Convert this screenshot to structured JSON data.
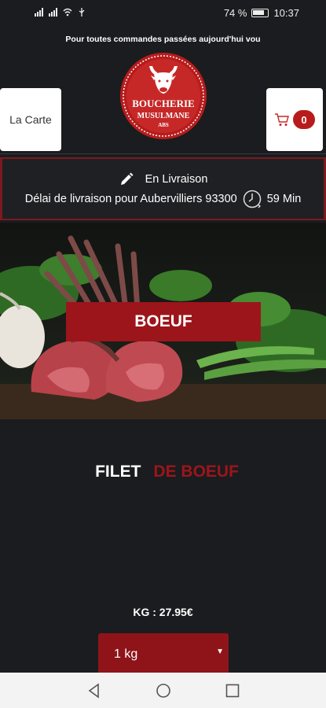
{
  "status": {
    "battery": "74 %",
    "time": "10:37"
  },
  "promo_text": "Pour toutes commandes passées aujourd'hui vou",
  "header": {
    "menu_label": "La Carte",
    "cart_count": "0",
    "logo": {
      "line1": "BOUCHERIE",
      "line2": "MUSULMANE",
      "line3": "ABS"
    }
  },
  "delivery": {
    "mode": "En Livraison",
    "delay_text": "Délai de livraison pour Aubervilliers 93300",
    "duration": "59 Min"
  },
  "category": {
    "label": "BOEUF"
  },
  "product": {
    "name_part1": "FILET",
    "name_part2": "DE BOEUF",
    "price": "KG : 27.95€"
  },
  "quantity_select": {
    "selected": "1 kg"
  },
  "colors": {
    "accent": "#9c151b",
    "background": "#1b1c1f"
  }
}
